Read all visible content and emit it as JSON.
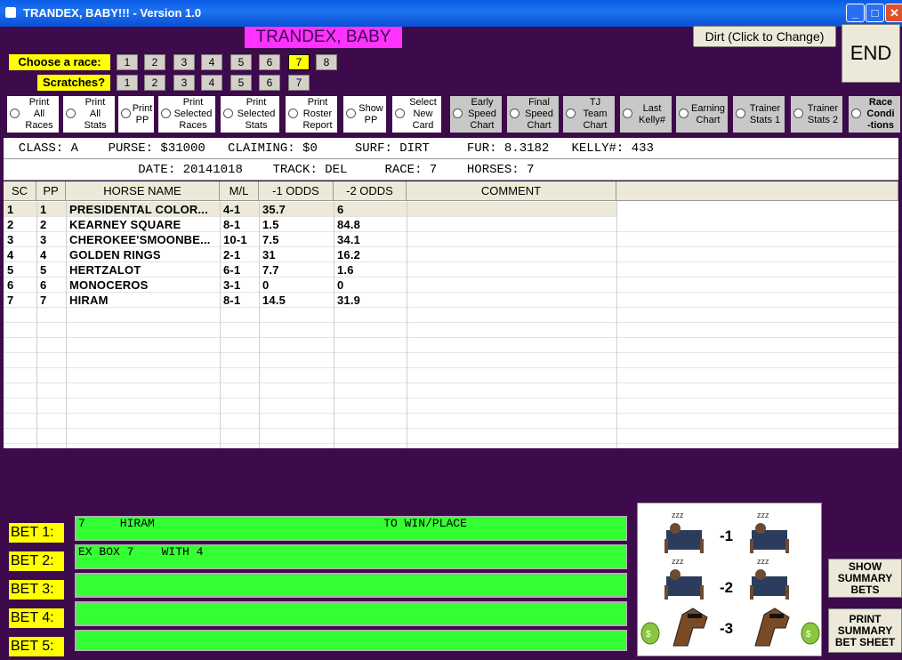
{
  "window": {
    "title": "TRANDEX, BABY!!! - Version 1.0"
  },
  "header": {
    "app_title": "TRANDEX, BABY !!!!",
    "surface_button": "Dirt (Click to Change)",
    "end_button": "END"
  },
  "race_select": {
    "label": "Choose  a race:",
    "races": [
      "1",
      "2",
      "3",
      "4",
      "5",
      "6",
      "7",
      "8"
    ],
    "selected": "7"
  },
  "scratches": {
    "label": "Scratches?",
    "items": [
      "1",
      "2",
      "3",
      "4",
      "5",
      "6",
      "7"
    ]
  },
  "options": [
    {
      "label": "Print\nAll\nRaces"
    },
    {
      "label": "Print\nAll\nStats"
    },
    {
      "label": "Print\nPP"
    },
    {
      "label": "Print\nSelected\nRaces"
    },
    {
      "label": "Print\nSelected\nStats"
    },
    {
      "label": "Print\nRoster\nReport"
    },
    {
      "label": "Show\nPP"
    },
    {
      "label": "Select\nNew\nCard"
    },
    {
      "label": "Early\nSpeed\nChart"
    },
    {
      "label": "Final\nSpeed\nChart"
    },
    {
      "label": "TJ\nTeam\nChart"
    },
    {
      "label": "Last\nKelly#"
    },
    {
      "label": "Earning\nChart"
    },
    {
      "label": "Trainer\nStats 1"
    },
    {
      "label": "Trainer\nStats 2"
    },
    {
      "label": "Race\nCondi\n-tions"
    }
  ],
  "race_info": {
    "line1": "  CLASS: A    PURSE: $31000   CLAIMING: $0     SURF: DIRT     FUR: 8.3182   KELLY#: 433",
    "line2": "                  DATE: 20141018    TRACK: DEL     RACE: 7    HORSES: 7"
  },
  "grid": {
    "headers": [
      "SC",
      "PP",
      "HORSE NAME",
      "M/L",
      "-1 ODDS",
      "-2 ODDS",
      "COMMENT"
    ],
    "rows": [
      {
        "sc": "1",
        "pp": "1",
        "name": "PRESIDENTAL COLOR...",
        "ml": "4-1",
        "odds1": "35.7",
        "odds2": "6",
        "comment": ""
      },
      {
        "sc": "2",
        "pp": "2",
        "name": "KEARNEY SQUARE",
        "ml": "8-1",
        "odds1": "1.5",
        "odds2": "84.8",
        "comment": ""
      },
      {
        "sc": "3",
        "pp": "3",
        "name": "CHEROKEE'SMOONBE...",
        "ml": "10-1",
        "odds1": "7.5",
        "odds2": "34.1",
        "comment": ""
      },
      {
        "sc": "4",
        "pp": "4",
        "name": "GOLDEN RINGS",
        "ml": "2-1",
        "odds1": "31",
        "odds2": "16.2",
        "comment": ""
      },
      {
        "sc": "5",
        "pp": "5",
        "name": "HERTZALOT",
        "ml": "6-1",
        "odds1": "7.7",
        "odds2": "1.6",
        "comment": ""
      },
      {
        "sc": "6",
        "pp": "6",
        "name": "MONOCEROS",
        "ml": "3-1",
        "odds1": "0",
        "odds2": "0",
        "comment": ""
      },
      {
        "sc": "7",
        "pp": "7",
        "name": "HIRAM",
        "ml": "8-1",
        "odds1": "14.5",
        "odds2": "31.9",
        "comment": ""
      }
    ]
  },
  "bets": [
    {
      "label": "BET 1:",
      "text": "7     HIRAM                                 TO WIN/PLACE"
    },
    {
      "label": "BET 2:",
      "text": "EX BOX 7    WITH 4"
    },
    {
      "label": "BET 3:",
      "text": ""
    },
    {
      "label": "BET 4:",
      "text": ""
    },
    {
      "label": "BET 5:",
      "text": ""
    }
  ],
  "picture": {
    "labels": [
      "-1",
      "-2",
      "-3"
    ]
  },
  "summary": {
    "show": "SHOW\nSUMMARY\nBETS",
    "print": "PRINT\nSUMMARY\nBET SHEET"
  },
  "colors": {
    "background": "#3d0a4b",
    "title_pink": "#ff33ff",
    "label_yellow": "#ffff00",
    "bet_green": "#33ff33"
  }
}
